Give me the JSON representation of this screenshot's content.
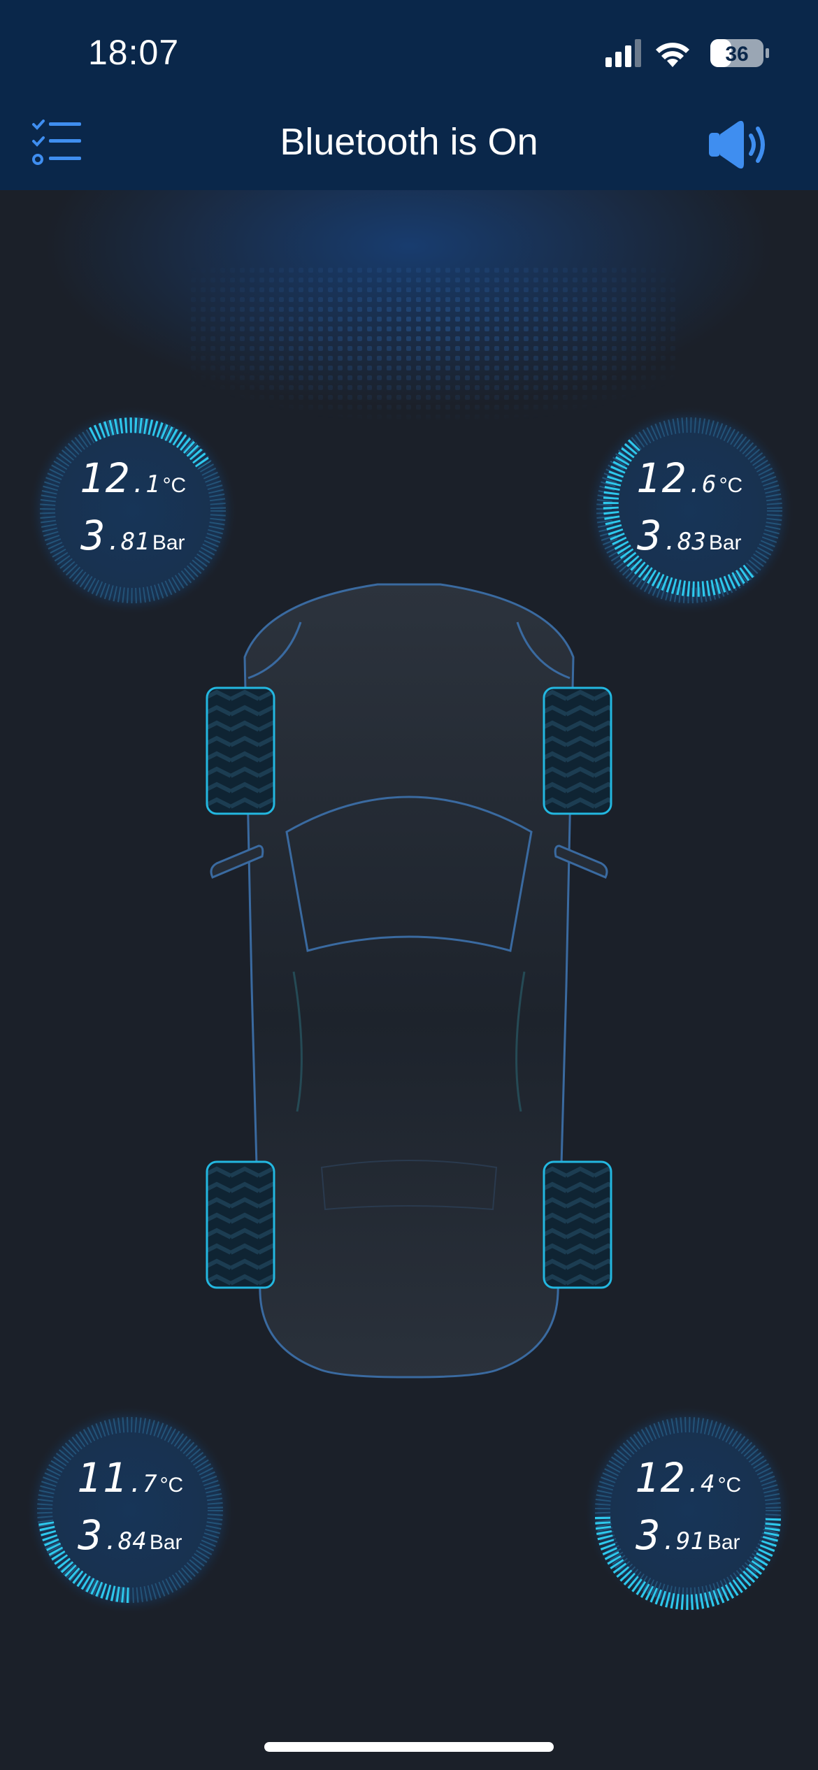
{
  "status_bar": {
    "time": "18:07",
    "battery": "36"
  },
  "nav": {
    "title": "Bluetooth is On",
    "left_icon": "checklist-icon",
    "right_icon": "speaker-icon"
  },
  "colors": {
    "background": "#1b2029",
    "header": "#0a274a",
    "accent": "#23b7e0",
    "icon_blue": "#3f8ef0"
  },
  "tires": {
    "front_left": {
      "temp_int": "12",
      "temp_dec": ".1",
      "temp_unit": "°C",
      "pres_int": "3",
      "pres_dec": ".81",
      "pres_unit": "Bar"
    },
    "front_right": {
      "temp_int": "12",
      "temp_dec": ".6",
      "temp_unit": "°C",
      "pres_int": "3",
      "pres_dec": ".83",
      "pres_unit": "Bar"
    },
    "rear_left": {
      "temp_int": "11",
      "temp_dec": ".7",
      "temp_unit": "°C",
      "pres_int": "3",
      "pres_dec": ".84",
      "pres_unit": "Bar"
    },
    "rear_right": {
      "temp_int": "12",
      "temp_dec": ".4",
      "temp_unit": "°C",
      "pres_int": "3",
      "pres_dec": ".91",
      "pres_unit": "Bar"
    }
  }
}
